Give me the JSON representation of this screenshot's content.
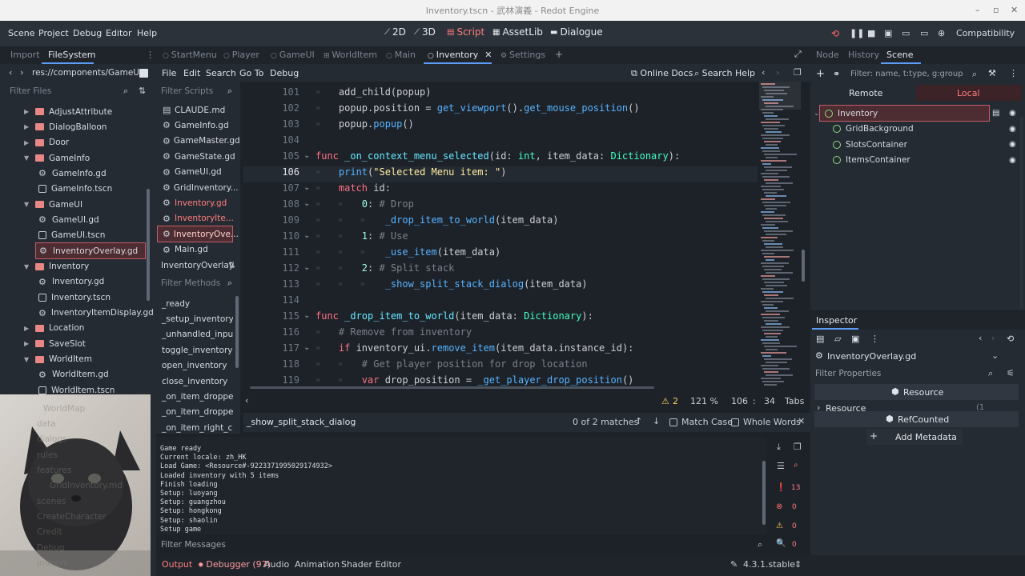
{
  "window": {
    "title": "Inventory.tscn - 武林演義 - Redot Engine"
  },
  "menu": [
    "Scene",
    "Project",
    "Debug",
    "Editor",
    "Help"
  ],
  "workspaces": [
    {
      "label": "2D",
      "icon": "2d-icon"
    },
    {
      "label": "3D",
      "icon": "3d-icon"
    },
    {
      "label": "Script",
      "icon": "script-icon",
      "active": true
    },
    {
      "label": "AssetLib",
      "icon": "assetlib-icon"
    },
    {
      "label": "Dialogue",
      "icon": "dialogue-icon"
    }
  ],
  "renderer": "Compatibility",
  "left_dock": {
    "tabs": [
      "Import",
      "FileSystem"
    ],
    "path": "res://components/GameUI/",
    "filter_placeholder": "Filter Files",
    "tree": [
      {
        "label": "AdjustAttribute",
        "type": "folder",
        "depth": 0
      },
      {
        "label": "DialogBalloon",
        "type": "folder",
        "depth": 0
      },
      {
        "label": "Door",
        "type": "folder",
        "depth": 0
      },
      {
        "label": "GameInfo",
        "type": "folder",
        "depth": 0,
        "open": true
      },
      {
        "label": "GameInfo.gd",
        "type": "script",
        "depth": 1
      },
      {
        "label": "GameInfo.tscn",
        "type": "scene",
        "depth": 1
      },
      {
        "label": "GameUI",
        "type": "folder",
        "depth": 0,
        "open": true
      },
      {
        "label": "GameUI.gd",
        "type": "script",
        "depth": 1
      },
      {
        "label": "GameUI.tscn",
        "type": "scene",
        "depth": 1
      },
      {
        "label": "InventoryOverlay.gd",
        "type": "script",
        "depth": 1,
        "selected": true
      },
      {
        "label": "Inventory",
        "type": "folder",
        "depth": 0,
        "open": true
      },
      {
        "label": "Inventory.gd",
        "type": "script",
        "depth": 1
      },
      {
        "label": "Inventory.tscn",
        "type": "scene",
        "depth": 1
      },
      {
        "label": "InventoryItemDisplay.gd",
        "type": "script",
        "depth": 1
      },
      {
        "label": "Location",
        "type": "folder",
        "depth": 0
      },
      {
        "label": "SaveSlot",
        "type": "folder",
        "depth": 0
      },
      {
        "label": "WorldItem",
        "type": "folder",
        "depth": 0,
        "open": true
      },
      {
        "label": "WorldItem.gd",
        "type": "script",
        "depth": 1
      },
      {
        "label": "WorldItem.tscn",
        "type": "scene",
        "depth": 1
      }
    ],
    "faded": [
      "WorldMap",
      "data",
      "dialogs",
      "rules",
      "features",
      "GridInventory.md",
      "scenes",
      "CreateCharacter",
      "Credit",
      "Debug",
      "indoors"
    ]
  },
  "editor_tabs": [
    "StartMenu",
    "Player",
    "GameUI",
    "WorldItem",
    "Main",
    "Inventory",
    "Settings"
  ],
  "script_menu": [
    "File",
    "Edit",
    "Search",
    "Go To",
    "Debug"
  ],
  "script_toolbar": {
    "online_docs": "Online Docs",
    "search_help": "Search Help"
  },
  "scripts": {
    "filter_placeholder": "Filter Scripts",
    "items": [
      {
        "label": "CLAUDE.md",
        "color": "#d6dae0"
      },
      {
        "label": "GameInfo.gd",
        "color": "#d6dae0"
      },
      {
        "label": "GameMaster.gd",
        "color": "#d6dae0"
      },
      {
        "label": "GameState.gd",
        "color": "#d6dae0"
      },
      {
        "label": "GameUI.gd",
        "color": "#d6dae0"
      },
      {
        "label": "GridInventory...",
        "color": "#d6dae0"
      },
      {
        "label": "Inventory.gd",
        "color": "#ff7d7d"
      },
      {
        "label": "InventoryIte...",
        "color": "#ff7d7d"
      },
      {
        "label": "InventoryOve...",
        "color": "#ffd1d1",
        "selected": true
      },
      {
        "label": "Main.gd",
        "color": "#d6dae0"
      }
    ],
    "current": "InventoryOverlay",
    "methods_placeholder": "Filter Methods",
    "methods": [
      "_ready",
      "_setup_inventory...",
      "_unhandled_input",
      "toggle_inventory",
      "open_inventory",
      "close_inventory",
      "_on_item_dropped",
      "_on_item_droppe...",
      "_on_item_right_cl..."
    ]
  },
  "code": {
    "lines": [
      {
        "n": "101",
        "fold": false,
        "seg": [
          [
            "id",
            "    add_child(popup)"
          ]
        ],
        "indent": 1
      },
      {
        "n": "102",
        "seg": [
          [
            "id",
            "    popup.position = "
          ],
          [
            "fn",
            "get_viewport"
          ],
          [
            "id",
            "()."
          ],
          [
            "fn",
            "get_mouse_position"
          ],
          [
            "id",
            "()"
          ]
        ],
        "indent": 1
      },
      {
        "n": "103",
        "seg": [
          [
            "id",
            "    popup."
          ],
          [
            "fn",
            "popup"
          ],
          [
            "id",
            "()"
          ]
        ],
        "indent": 1
      },
      {
        "n": "104",
        "seg": [
          [
            "id",
            ""
          ]
        ]
      },
      {
        "n": "105",
        "fold": true,
        "seg": [
          [
            "kw",
            "func "
          ],
          [
            "fd",
            "_on_context_menu_selected"
          ],
          [
            "id",
            "(id: "
          ],
          [
            "ty",
            "int"
          ],
          [
            "id",
            ", item_data: "
          ],
          [
            "ty",
            "Dictionary"
          ],
          [
            "id",
            "):"
          ]
        ]
      },
      {
        "n": "106",
        "current": true,
        "seg": [
          [
            "id",
            "    "
          ],
          [
            "fn",
            "print"
          ],
          [
            "id",
            "("
          ],
          [
            "str",
            "\"Selected Menu item: \""
          ],
          [
            "id",
            ")"
          ]
        ],
        "indent": 1
      },
      {
        "n": "107",
        "fold": true,
        "seg": [
          [
            "id",
            "    "
          ],
          [
            "kw",
            "match"
          ],
          [
            "id",
            " id:"
          ]
        ],
        "indent": 1
      },
      {
        "n": "108",
        "fold": true,
        "seg": [
          [
            "id",
            "        "
          ],
          [
            "nm",
            "0"
          ],
          [
            "id",
            ": "
          ],
          [
            "cm",
            "# Drop"
          ]
        ],
        "indent": 2
      },
      {
        "n": "109",
        "seg": [
          [
            "id",
            "            "
          ],
          [
            "fn",
            "_drop_item_to_world"
          ],
          [
            "id",
            "(item_data)"
          ]
        ],
        "indent": 3
      },
      {
        "n": "110",
        "fold": true,
        "seg": [
          [
            "id",
            "        "
          ],
          [
            "nm",
            "1"
          ],
          [
            "id",
            ": "
          ],
          [
            "cm",
            "# Use"
          ]
        ],
        "indent": 2
      },
      {
        "n": "111",
        "seg": [
          [
            "id",
            "            "
          ],
          [
            "fn",
            "_use_item"
          ],
          [
            "id",
            "(item_data)"
          ]
        ],
        "indent": 3
      },
      {
        "n": "112",
        "fold": true,
        "seg": [
          [
            "id",
            "        "
          ],
          [
            "nm",
            "2"
          ],
          [
            "id",
            ": "
          ],
          [
            "cm",
            "# Split stack"
          ]
        ],
        "indent": 2
      },
      {
        "n": "113",
        "seg": [
          [
            "id",
            "            "
          ],
          [
            "fn",
            "_show_split_stack_dialog"
          ],
          [
            "id",
            "(item_data)"
          ]
        ],
        "indent": 3
      },
      {
        "n": "114",
        "seg": [
          [
            "id",
            ""
          ]
        ]
      },
      {
        "n": "115",
        "fold": true,
        "seg": [
          [
            "kw",
            "func "
          ],
          [
            "fd",
            "_drop_item_to_world"
          ],
          [
            "id",
            "(item_data: "
          ],
          [
            "ty",
            "Dictionary"
          ],
          [
            "id",
            "):"
          ]
        ]
      },
      {
        "n": "116",
        "seg": [
          [
            "id",
            "    "
          ],
          [
            "cm",
            "# Remove from inventory"
          ]
        ],
        "indent": 1
      },
      {
        "n": "117",
        "fold": true,
        "seg": [
          [
            "id",
            "    "
          ],
          [
            "kw",
            "if"
          ],
          [
            "id",
            " inventory_ui."
          ],
          [
            "fn",
            "remove_item"
          ],
          [
            "id",
            "(item_data.instance_id):"
          ]
        ],
        "indent": 1
      },
      {
        "n": "118",
        "seg": [
          [
            "id",
            "        "
          ],
          [
            "cm",
            "# Get player position for drop location"
          ]
        ],
        "indent": 2
      },
      {
        "n": "119",
        "seg": [
          [
            "id",
            "        "
          ],
          [
            "kw",
            "var"
          ],
          [
            "id",
            " drop_position = "
          ],
          [
            "fn",
            "_get_player_drop_position"
          ],
          [
            "id",
            "()"
          ]
        ],
        "indent": 2
      }
    ]
  },
  "status": {
    "warnings": "2",
    "zoom": "121 %",
    "line": "106",
    "col": "34",
    "indent": "Tabs"
  },
  "find": {
    "query": "_show_split_stack_dialog",
    "matches": "0 of 2 matches",
    "match_case": "Match Case",
    "whole_words": "Whole Words"
  },
  "output": {
    "lines": [
      "Game ready",
      "Current locale: zh_HK",
      "Load Game: <Resource#-9223371995029174932>",
      "Loaded inventory with 5 items",
      "Finish loading",
      "Setup: luoyang",
      "Setup: guangzhou",
      "Setup: hongkong",
      "Setup: shaolin",
      "Setup game"
    ],
    "filter_placeholder": "Filter Messages",
    "counts": {
      "messages": "13",
      "errors": "0",
      "warnings": "0",
      "editor": "0",
      "bottom": "0"
    }
  },
  "bottom_tabs": [
    "Output",
    "Debugger (97)",
    "Audio",
    "Animation",
    "Shader Editor"
  ],
  "version": "4.3.1.stable",
  "right_dock": {
    "tabs": [
      "Node",
      "History",
      "Scene"
    ],
    "filter_placeholder": "Filter: name, t:type, g:group",
    "mode_tabs": [
      "Remote",
      "Local"
    ],
    "nodes": [
      {
        "label": "Inventory",
        "root": true
      },
      {
        "label": "GridBackground"
      },
      {
        "label": "SlotsContainer"
      },
      {
        "label": "ItemsContainer"
      }
    ]
  },
  "inspector": {
    "title": "Inspector",
    "resource": "InventoryOverlay.gd",
    "filter_placeholder": "Filter Properties",
    "section1": "Resource",
    "row_label": "Resource",
    "row_value": "(1 change)",
    "section2": "RefCounted",
    "add_metadata": "Add Metadata"
  }
}
